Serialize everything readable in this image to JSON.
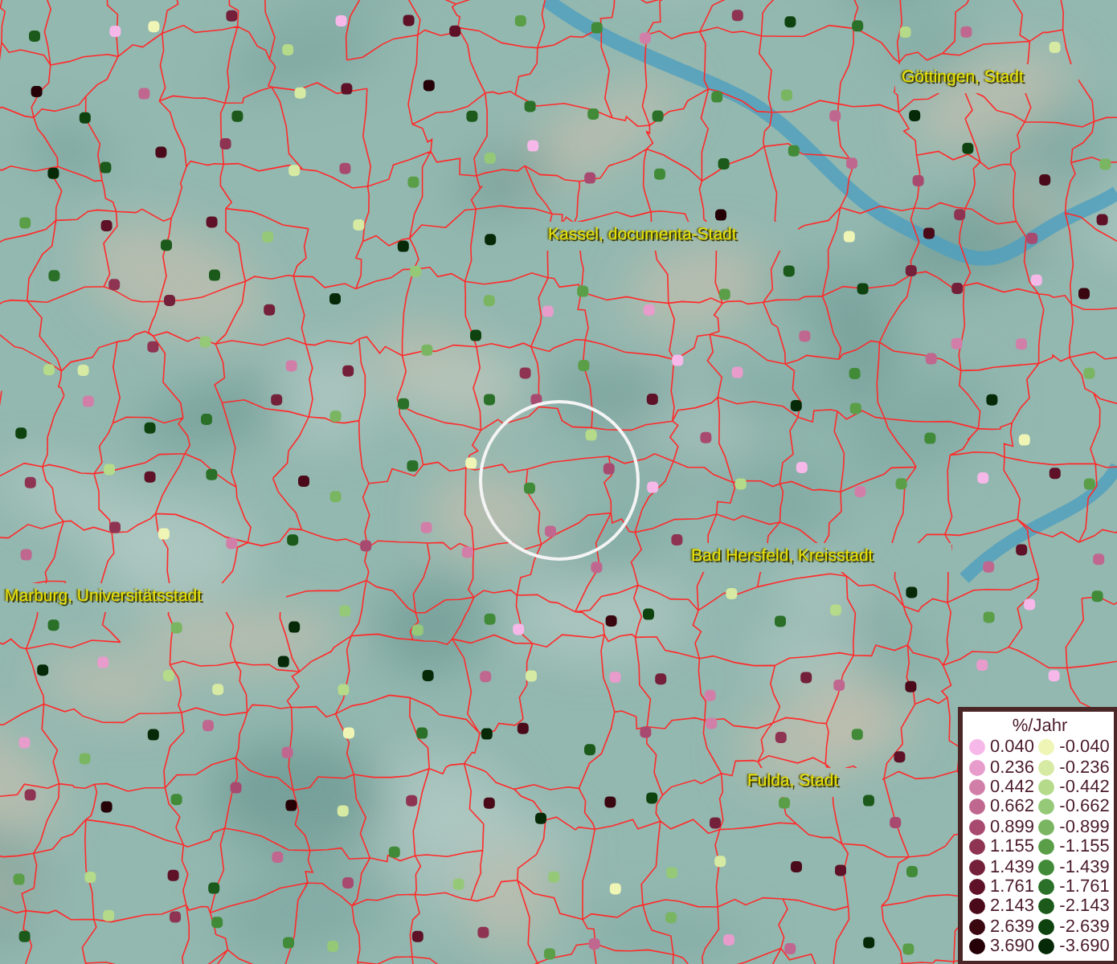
{
  "map": {
    "places": [
      {
        "name": "Göttingen, Stadt"
      },
      {
        "name": "Kassel, documenta-Stadt"
      },
      {
        "name": "Marburg, Universitätsstadt"
      },
      {
        "name": "Bad Hersfeld, Kreisstadt"
      },
      {
        "name": "Fulda, Stadt"
      }
    ]
  },
  "legend": {
    "title": "%/Jahr",
    "increase": [
      {
        "label": "0.040",
        "color": "#f5b8e8"
      },
      {
        "label": "0.236",
        "color": "#e79ccc"
      },
      {
        "label": "0.442",
        "color": "#d17fa9"
      },
      {
        "label": "0.662",
        "color": "#c0678f"
      },
      {
        "label": "0.899",
        "color": "#a84a70"
      },
      {
        "label": "1.155",
        "color": "#8e3452"
      },
      {
        "label": "1.439",
        "color": "#74203a"
      },
      {
        "label": "1.761",
        "color": "#5e1127"
      },
      {
        "label": "2.143",
        "color": "#4a0a19"
      },
      {
        "label": "2.639",
        "color": "#3a0610"
      },
      {
        "label": "3.690",
        "color": "#250006"
      }
    ],
    "decrease": [
      {
        "label": "-0.040",
        "color": "#eef5b5"
      },
      {
        "label": "-0.236",
        "color": "#d6eaa3"
      },
      {
        "label": "-0.442",
        "color": "#b4da8a"
      },
      {
        "label": "-0.662",
        "color": "#95c978"
      },
      {
        "label": "-0.899",
        "color": "#7ab562"
      },
      {
        "label": "-1.155",
        "color": "#5a9e48"
      },
      {
        "label": "-1.439",
        "color": "#418b38"
      },
      {
        "label": "-1.761",
        "color": "#2a7028"
      },
      {
        "label": "-2.143",
        "color": "#1b5a1a"
      },
      {
        "label": "-2.639",
        "color": "#0e430f"
      },
      {
        "label": "-3.690",
        "color": "#062a07"
      }
    ]
  }
}
